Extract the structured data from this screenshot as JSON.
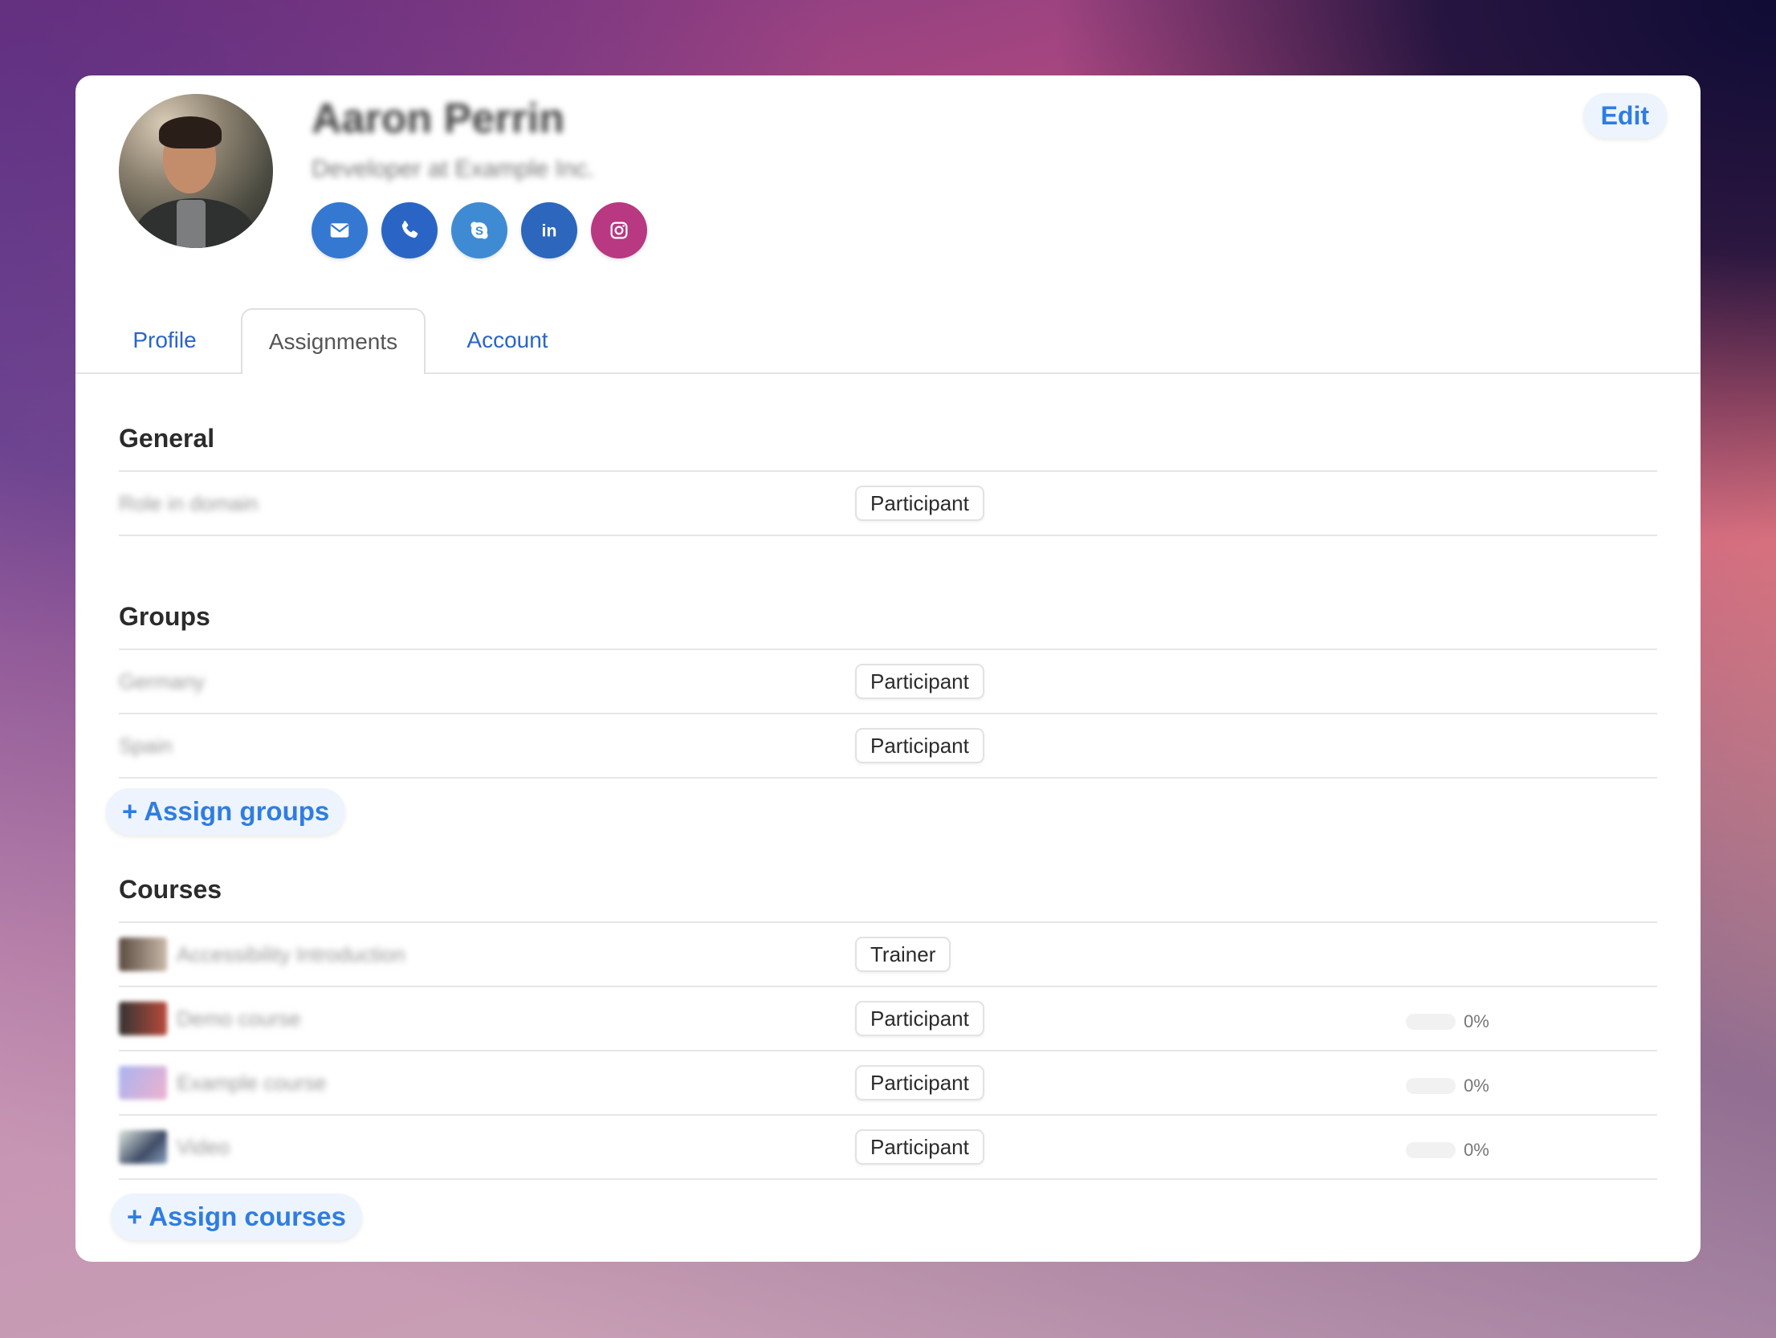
{
  "profile": {
    "name": "Aaron Perrin",
    "subtitle": "Developer at Example Inc.",
    "edit_label": "Edit",
    "socials": [
      {
        "name": "email",
        "icon": "envelope-icon",
        "color": "#3478d1"
      },
      {
        "name": "phone",
        "icon": "phone-icon",
        "color": "#2a65c6"
      },
      {
        "name": "skype",
        "icon": "skype-icon",
        "color": "#3e8bd4"
      },
      {
        "name": "linkedin",
        "icon": "linkedin-icon",
        "color": "#2c66bd"
      },
      {
        "name": "instagram",
        "icon": "instagram-icon",
        "color": "#b83882"
      }
    ]
  },
  "tabs": [
    {
      "label": "Profile",
      "active": false
    },
    {
      "label": "Assignments",
      "active": true
    },
    {
      "label": "Account",
      "active": false
    }
  ],
  "general": {
    "title": "General",
    "rows": [
      {
        "label": "Role in domain",
        "role": "Participant"
      }
    ]
  },
  "groups": {
    "title": "Groups",
    "rows": [
      {
        "label": "Germany",
        "role": "Participant"
      },
      {
        "label": "Spain",
        "role": "Participant"
      }
    ],
    "assign_label": "+ Assign groups"
  },
  "courses": {
    "title": "Courses",
    "rows": [
      {
        "label": "Accessibility Introduction",
        "role": "Trainer",
        "progress": null
      },
      {
        "label": "Demo course",
        "role": "Participant",
        "progress": 0,
        "progress_text": "0%"
      },
      {
        "label": "Example course",
        "role": "Participant",
        "progress": 0,
        "progress_text": "0%"
      },
      {
        "label": "Video",
        "role": "Participant",
        "progress": 0,
        "progress_text": "0%"
      }
    ],
    "assign_label": "+ Assign courses"
  },
  "colors": {
    "accent": "#2f7de1",
    "link": "#2a65c6",
    "button_bg": "#eef4fd"
  }
}
